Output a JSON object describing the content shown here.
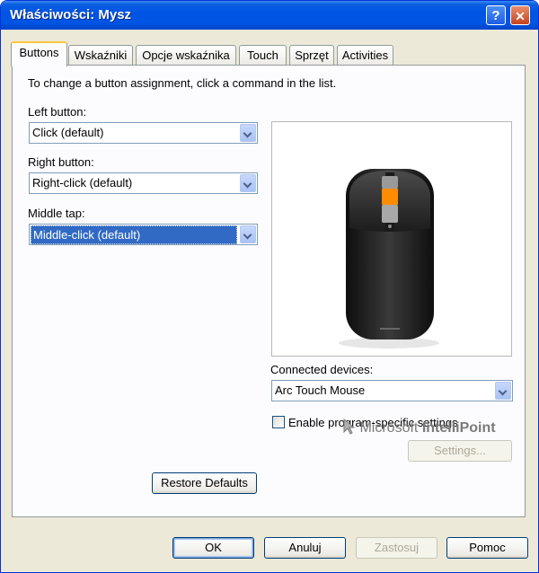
{
  "window": {
    "title": "Właściwości: Mysz"
  },
  "titlebar": {
    "help_label": "?",
    "close_label": "✕"
  },
  "tabs": [
    {
      "label": "Buttons",
      "active": true
    },
    {
      "label": "Wskaźniki"
    },
    {
      "label": "Opcje wskaźnika"
    },
    {
      "label": "Touch"
    },
    {
      "label": "Sprzęt"
    },
    {
      "label": "Activities"
    }
  ],
  "buttons_tab": {
    "instruction": "To change a button assignment, click a command in the list.",
    "left_button": {
      "label": "Left button:",
      "value": "Click (default)"
    },
    "right_button": {
      "label": "Right button:",
      "value": "Right-click (default)"
    },
    "middle_tap": {
      "label": "Middle tap:",
      "value": "Middle-click (default)"
    },
    "restore_label": "Restore Defaults",
    "connected_devices": {
      "label": "Connected devices:",
      "value": "Arc Touch Mouse"
    },
    "program_specific": {
      "label": "Enable program-specific settings",
      "checked": false
    },
    "settings_label": "Settings...",
    "brand": {
      "prefix": "Microsoft",
      "product": "IntelliPoint"
    }
  },
  "footer": {
    "ok_label": "OK",
    "cancel_label": "Anuluj",
    "apply_label": "Zastosuj",
    "help_label": "Pomoc"
  },
  "colors": {
    "titlebar": "#0054e3",
    "selection": "#316ac5",
    "accent_tab": "#ffc83c",
    "mouse_accent": "#ff8c00"
  },
  "icons": [
    "help-icon",
    "close-icon",
    "dropdown-arrow-icon",
    "intellipoint-cursor-icon"
  ]
}
